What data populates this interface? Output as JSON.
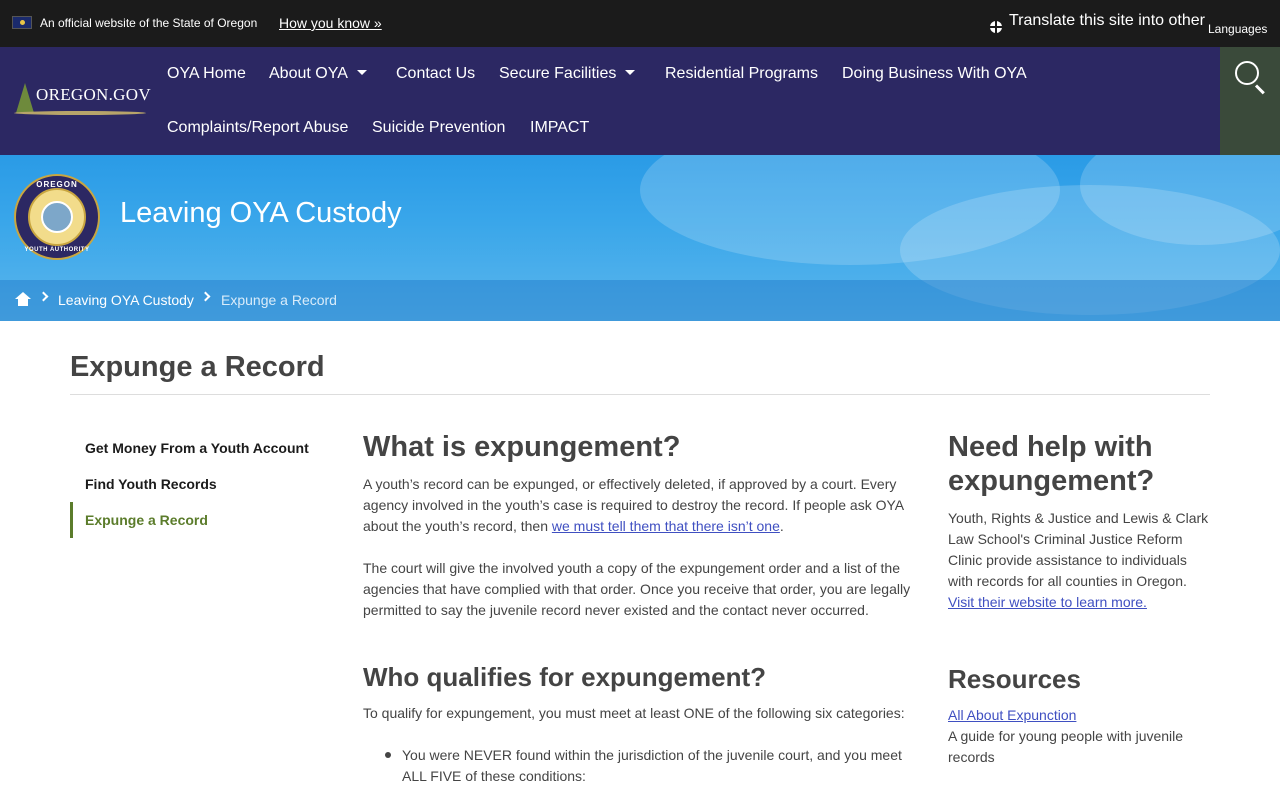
{
  "topbar": {
    "official": "An official website of the State of Oregon",
    "how_you_know": "How you know »",
    "translate": "Translate this site into other",
    "languages": "Languages"
  },
  "logo": {
    "text": "OREGON.GOV"
  },
  "nav": {
    "items": [
      "OYA Home",
      "About OYA",
      "Contact Us",
      "Secure Facilities",
      "Residential Programs",
      "Doing Business With OYA",
      "Complaints/Report Abuse",
      "Suicide Prevention",
      "IMPACT"
    ]
  },
  "hero": {
    "seal_top": "OREGON",
    "seal_bottom": "YOUTH AUTHORITY",
    "title": "Leaving OYA Custody"
  },
  "breadcrumb": {
    "items": [
      "Leaving OYA Custody",
      "Expunge a Record"
    ]
  },
  "page_title": "Expunge a Record",
  "sidenav": {
    "items": [
      "Get Money From a Youth Account",
      "Find Youth Records",
      "Expunge a Record"
    ],
    "active_index": 2
  },
  "main": {
    "h_what": "What is expungement?",
    "p1_lines": [
      "A youth’s record can be expunged, or effectively deleted, if approved by a court. Every",
      "agency involved in the youth’s case is required to destroy the record. If people ask OYA",
      "about the youth’s record, then "
    ],
    "p1_link": "we must tell them that there isn’t one",
    "p1_end": ".",
    "p2_lines": [
      "The court will give the involved youth a copy of the expungement order and a list of the",
      "agencies that have complied with that order. Once you receive that order, you are legally",
      "permitted to say the juvenile record never existed and the contact never occurred."
    ],
    "h_who": "Who qualifies for expungement?",
    "p3": "To qualify for expungement, you must meet at least ONE of the following six categories:",
    "bullet1_lines": [
      "You were NEVER found within the jurisdiction of the juvenile court, and you meet",
      "ALL FIVE of these conditions:"
    ]
  },
  "aside": {
    "h_help": [
      "Need help with",
      "expungement?"
    ],
    "help_lines": [
      "Youth, Rights & Justice and Lewis & Clark",
      "Law School's Criminal Justice Reform",
      "Clinic provide assistance to individuals",
      "with records for all counties in Oregon."
    ],
    "help_link": "Visit their website to learn more.",
    "h_resources": "Resources",
    "res_link": "All About Expunction",
    "res_desc_lines": [
      "A guide for young people with juvenile",
      "records"
    ]
  },
  "colors": {
    "topbar": "#1b1b1b",
    "nav": "#2c2863",
    "hero": "#2a9be6",
    "link": "#3f4fc1",
    "sidenav_active": "#5b7c2b"
  }
}
